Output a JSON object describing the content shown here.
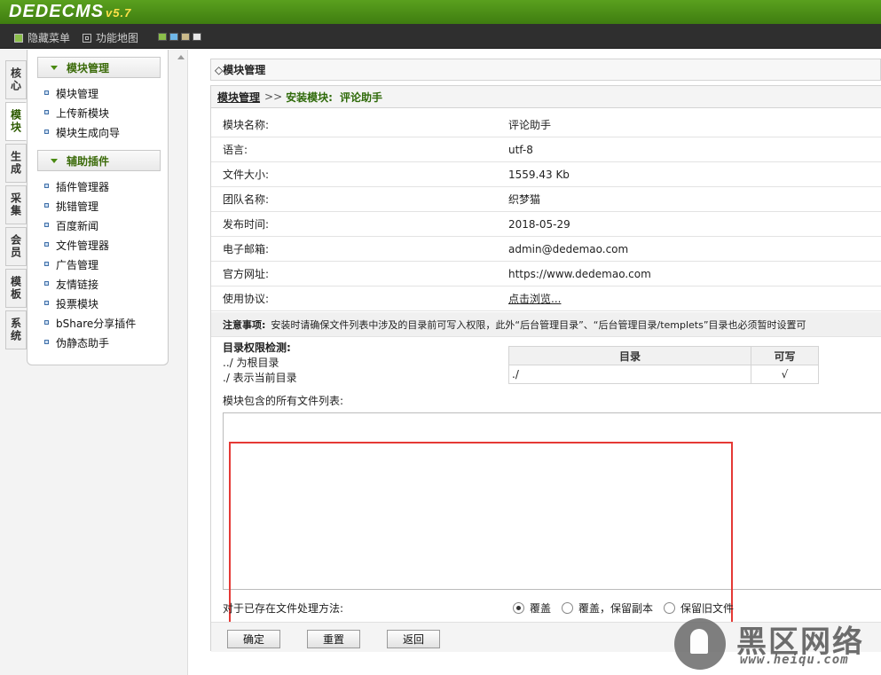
{
  "header": {
    "logo": "DEDECMS",
    "version": "v5.7",
    "menu": [
      {
        "label": "隐藏菜单",
        "icon": "panel-icon"
      },
      {
        "label": "功能地图",
        "icon": "grid-icon"
      }
    ],
    "swatch_colors": [
      "#8bbf4a",
      "#6fb7e8",
      "#c9b98a",
      "#e6e6e6"
    ]
  },
  "sidebar": {
    "tabs": [
      "核心",
      "模块",
      "生成",
      "采集",
      "会员",
      "模板",
      "系统"
    ],
    "active_tab": "模块",
    "groups": [
      {
        "title": "模块管理",
        "items": [
          "模块管理",
          "上传新模块",
          "模块生成向导"
        ]
      },
      {
        "title": "辅助插件",
        "items": [
          "插件管理器",
          "挑错管理",
          "百度新闻",
          "文件管理器",
          "广告管理",
          "友情链接",
          "投票模块",
          "bShare分享插件",
          "伪静态助手"
        ]
      }
    ]
  },
  "main": {
    "title": "◇模块管理",
    "breadcrumb": {
      "root": "模块管理",
      "sep": ">>",
      "step": "安装模块:",
      "name": "评论助手"
    },
    "info_rows": [
      {
        "key": "模块名称:",
        "value": "评论助手"
      },
      {
        "key": "语言:",
        "value": "utf-8"
      },
      {
        "key": "文件大小:",
        "value": "1559.43 Kb"
      },
      {
        "key": "团队名称:",
        "value": "织梦猫"
      },
      {
        "key": "发布时间:",
        "value": "2018-05-29"
      },
      {
        "key": "电子邮箱:",
        "value": "admin@dedemao.com"
      },
      {
        "key": "官方网址:",
        "value": "https://www.dedemao.com"
      },
      {
        "key": "使用协议:",
        "value": "点击浏览..."
      }
    ],
    "note": {
      "label": "注意事项:",
      "text": "安装时请确保文件列表中涉及的目录前可写入权限，此外“后台管理目录”、“后台管理目录/templets”目录也必须暂时设置可"
    },
    "dir_check": {
      "title": "目录权限检测:",
      "line1": "../ 为根目录",
      "line2": "./ 表示当前目录",
      "headers": [
        "目录",
        "可写"
      ],
      "rows": [
        {
          "dir": "./",
          "writable": "√"
        }
      ]
    },
    "file_list_label": "模块包含的所有文件列表:",
    "file_list_value": "",
    "existing_label": "对于已存在文件处理方法:",
    "options": [
      "覆盖",
      "覆盖，保留副本",
      "保留旧文件"
    ],
    "selected_option": "覆盖",
    "buttons": [
      "确定",
      "重置",
      "返回"
    ]
  },
  "watermark": {
    "big": "黑区网络",
    "small": "www.heiqu.com"
  }
}
